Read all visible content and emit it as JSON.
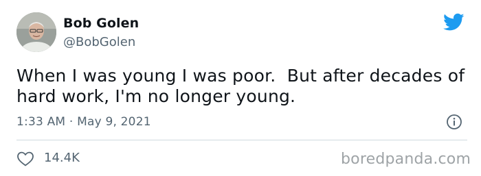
{
  "author": {
    "display_name": "Bob Golen",
    "handle": "@BobGolen"
  },
  "tweet": {
    "lines": [
      "When I was young I was poor.  But after decades of",
      "hard work, I'm no longer young."
    ],
    "time": "1:33 AM",
    "separator": " · ",
    "date": "May 9, 2021"
  },
  "engagement": {
    "likes": "14.4K"
  },
  "watermark": "boredpanda.com",
  "icons": {
    "brand": "twitter-bird-icon",
    "info": "info-icon",
    "like": "heart-icon"
  },
  "colors": {
    "twitter_blue": "#1d9bf0",
    "secondary_text": "#536471",
    "divider": "#cfd9de",
    "watermark": "#9ea3a6"
  }
}
